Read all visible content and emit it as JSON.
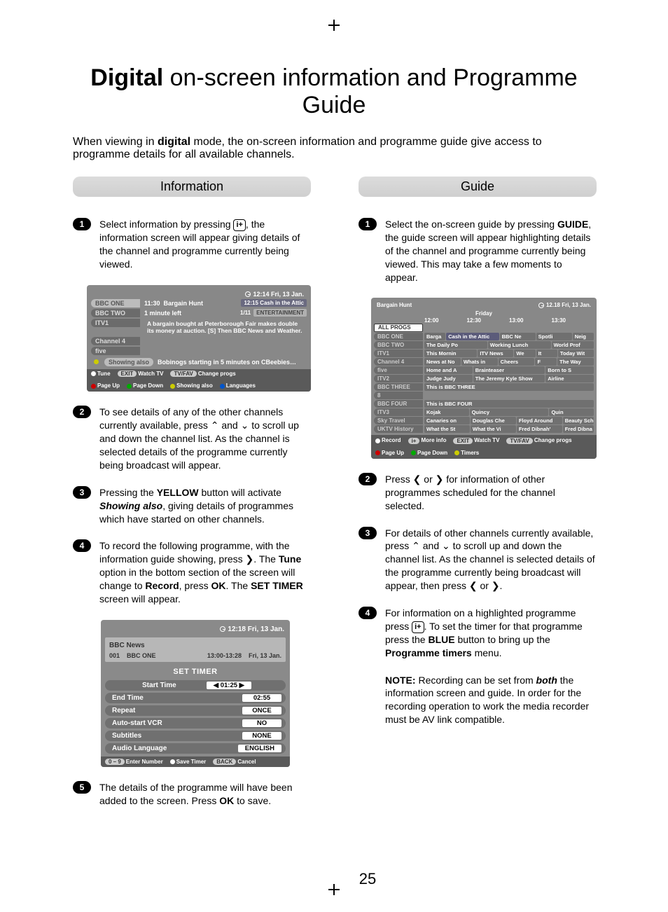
{
  "page_number": "25",
  "title_bold": "Digital",
  "title_rest": " on-screen information and Programme Guide",
  "intro_pre": "When viewing in ",
  "intro_bold": "digital",
  "intro_post": " mode, the on-screen information and programme guide give access to programme details for all available channels.",
  "left": {
    "header": "Information",
    "steps": {
      "s1": {
        "n": "1",
        "a": "Select information by pressing ",
        "key": "i+",
        "b": ", the information screen will appear giving details of the channel and programme currently being viewed."
      },
      "s2": {
        "n": "2",
        "t": "To see details of any of the other channels currently available, press ⌃ and ⌄ to scroll up and down the channel list. As the channel is selected details of the programme currently being broadcast will appear."
      },
      "s3": {
        "n": "3",
        "a": "Pressing the ",
        "b": "YELLOW",
        "c": " button will activate ",
        "d": "Showing also",
        "e": ", giving details of programmes which have started on other channels."
      },
      "s4": {
        "n": "4",
        "a": "To record the following programme, with the information guide showing, press ❯. The ",
        "b": "Tune",
        "c": " option in the bottom section of the screen will change to ",
        "d": "Record",
        "e": ", press ",
        "f": "OK",
        "g": ". The ",
        "h": "SET TIMER",
        "i": " screen will appear."
      },
      "s5": {
        "n": "5",
        "a": "The details of the programme will have been added to the screen. Press ",
        "b": "OK",
        "c": " to save."
      }
    },
    "osd1": {
      "clock": "12:14 Fri, 13 Jan.",
      "channels": [
        "BBC ONE",
        "BBC TWO",
        "ITV1",
        "Channel 4",
        "five"
      ],
      "prog_time": "11:30",
      "prog_name": "Bargain Hunt",
      "next": "12:15 Cash in the Attic",
      "left_time": "1 minute left",
      "badge_idx": "1/11",
      "badge_cat": "ENTERTAINMENT",
      "desc": "A bargain bought at Peterborough Fair makes double its money at auction. [S] Then BBC News and Weather.",
      "also_label": "Showing also",
      "also_text": "Bobinogs starting in 5 minutes on CBeebies…",
      "foot": {
        "tune": "Tune",
        "exit": "EXIT",
        "watch": "Watch TV",
        "tvfav": "TV/FAV",
        "change": "Change progs",
        "pu": "Page Up",
        "pd": "Page Down",
        "sa": "Showing also",
        "lang": "Languages"
      }
    },
    "osd2": {
      "clock": "12:18 Fri, 13 Jan.",
      "prog": "BBC News",
      "ch_num": "001",
      "ch_name": "BBC ONE",
      "time": "13:00-13:28",
      "date": "Fri, 13 Jan.",
      "title": "SET TIMER",
      "rows": [
        {
          "k": "Start Time",
          "v": "01:25"
        },
        {
          "k": "End Time",
          "v": "02:55"
        },
        {
          "k": "Repeat",
          "v": "ONCE"
        },
        {
          "k": "Auto-start VCR",
          "v": "NO"
        },
        {
          "k": "Subtitles",
          "v": "NONE"
        },
        {
          "k": "Audio Language",
          "v": "ENGLISH"
        }
      ],
      "foot": {
        "num": "0 – 9",
        "enter": "Enter Number",
        "save": "Save Timer",
        "back": "BACK",
        "cancel": "Cancel"
      }
    }
  },
  "right": {
    "header": "Guide",
    "steps": {
      "s1": {
        "n": "1",
        "a": "Select the on-screen guide by pressing ",
        "b": "GUIDE",
        "c": ", the guide screen will appear highlighting details of the channel and programme currently being viewed. This may take a few moments to appear."
      },
      "s2": {
        "n": "2",
        "t": "Press ❮ or ❯ for information of other programmes scheduled for the channel selected."
      },
      "s3": {
        "n": "3",
        "t": "For details of other channels currently available, press ⌃ and ⌄ to scroll up and down the channel list. As the channel is selected details of the programme currently being broadcast will appear, then press ❮ or ❯."
      },
      "s4": {
        "n": "4",
        "a": "For information on a highlighted programme press ",
        "key": "i+",
        "b": ". To set the timer for that programme press the ",
        "c": "BLUE",
        "d": " button to bring up the ",
        "e": "Programme timers",
        "f": " menu."
      },
      "note": {
        "a": "NOTE:",
        "b": " Recording can be set from ",
        "c": "both",
        "d": " the information screen and guide. In order for the recording operation to work the media recorder must be AV link compatible."
      }
    },
    "guide": {
      "title": "Bargain Hunt",
      "clock": "12.18 Fri, 13 Jan.",
      "day": "Friday",
      "times": [
        "12:00",
        "12:30",
        "13:00",
        "13:30"
      ],
      "rows": [
        {
          "ch": "ALL PROGS",
          "sel": true,
          "slots": []
        },
        {
          "ch": "BBC ONE",
          "slots": [
            "Barga",
            "Cash in the Attic",
            "BBC Ne",
            "Spotli",
            "Neig"
          ]
        },
        {
          "ch": "BBC TWO",
          "slots": [
            "The Daily Po",
            "Working Lunch",
            "World Prof"
          ]
        },
        {
          "ch": "ITV1",
          "slots": [
            "This Mornin",
            "ITV News",
            "We",
            "It",
            "Today Wit"
          ]
        },
        {
          "ch": "Channel 4",
          "slots": [
            "News at No",
            "Whats in",
            "Cheers",
            "F",
            "The Way"
          ]
        },
        {
          "ch": "five",
          "slots": [
            "Home and A",
            "Brainteaser",
            "Born to S"
          ]
        },
        {
          "ch": "ITV2",
          "slots": [
            "Judge Judy",
            "The Jeremy Kyle Show",
            "Airline"
          ]
        },
        {
          "ch": "BBC THREE",
          "wide": "This is BBC THREE"
        },
        {
          "ch": "8",
          "slots": []
        },
        {
          "ch": "BBC FOUR",
          "wide": "This is BBC FOUR"
        },
        {
          "ch": "ITV3",
          "slots": [
            "Kojak",
            "Quincy",
            "Quin"
          ]
        },
        {
          "ch": "Sky Travel",
          "slots": [
            "Canaries on",
            "Douglas Che",
            "Floyd Around",
            "Beauty Sch"
          ]
        },
        {
          "ch": "UKTV History",
          "slots": [
            "What the St",
            "What the Vi",
            "Fred Dibnah'",
            "Fred Dibna"
          ]
        }
      ],
      "foot": {
        "rec": "Record",
        "more": "More info",
        "exit": "EXIT",
        "watch": "Watch TV",
        "tvfav": "TV/FAV",
        "change": "Change progs",
        "pu": "Page Up",
        "pd": "Page Down",
        "timers": "Timers"
      }
    }
  }
}
